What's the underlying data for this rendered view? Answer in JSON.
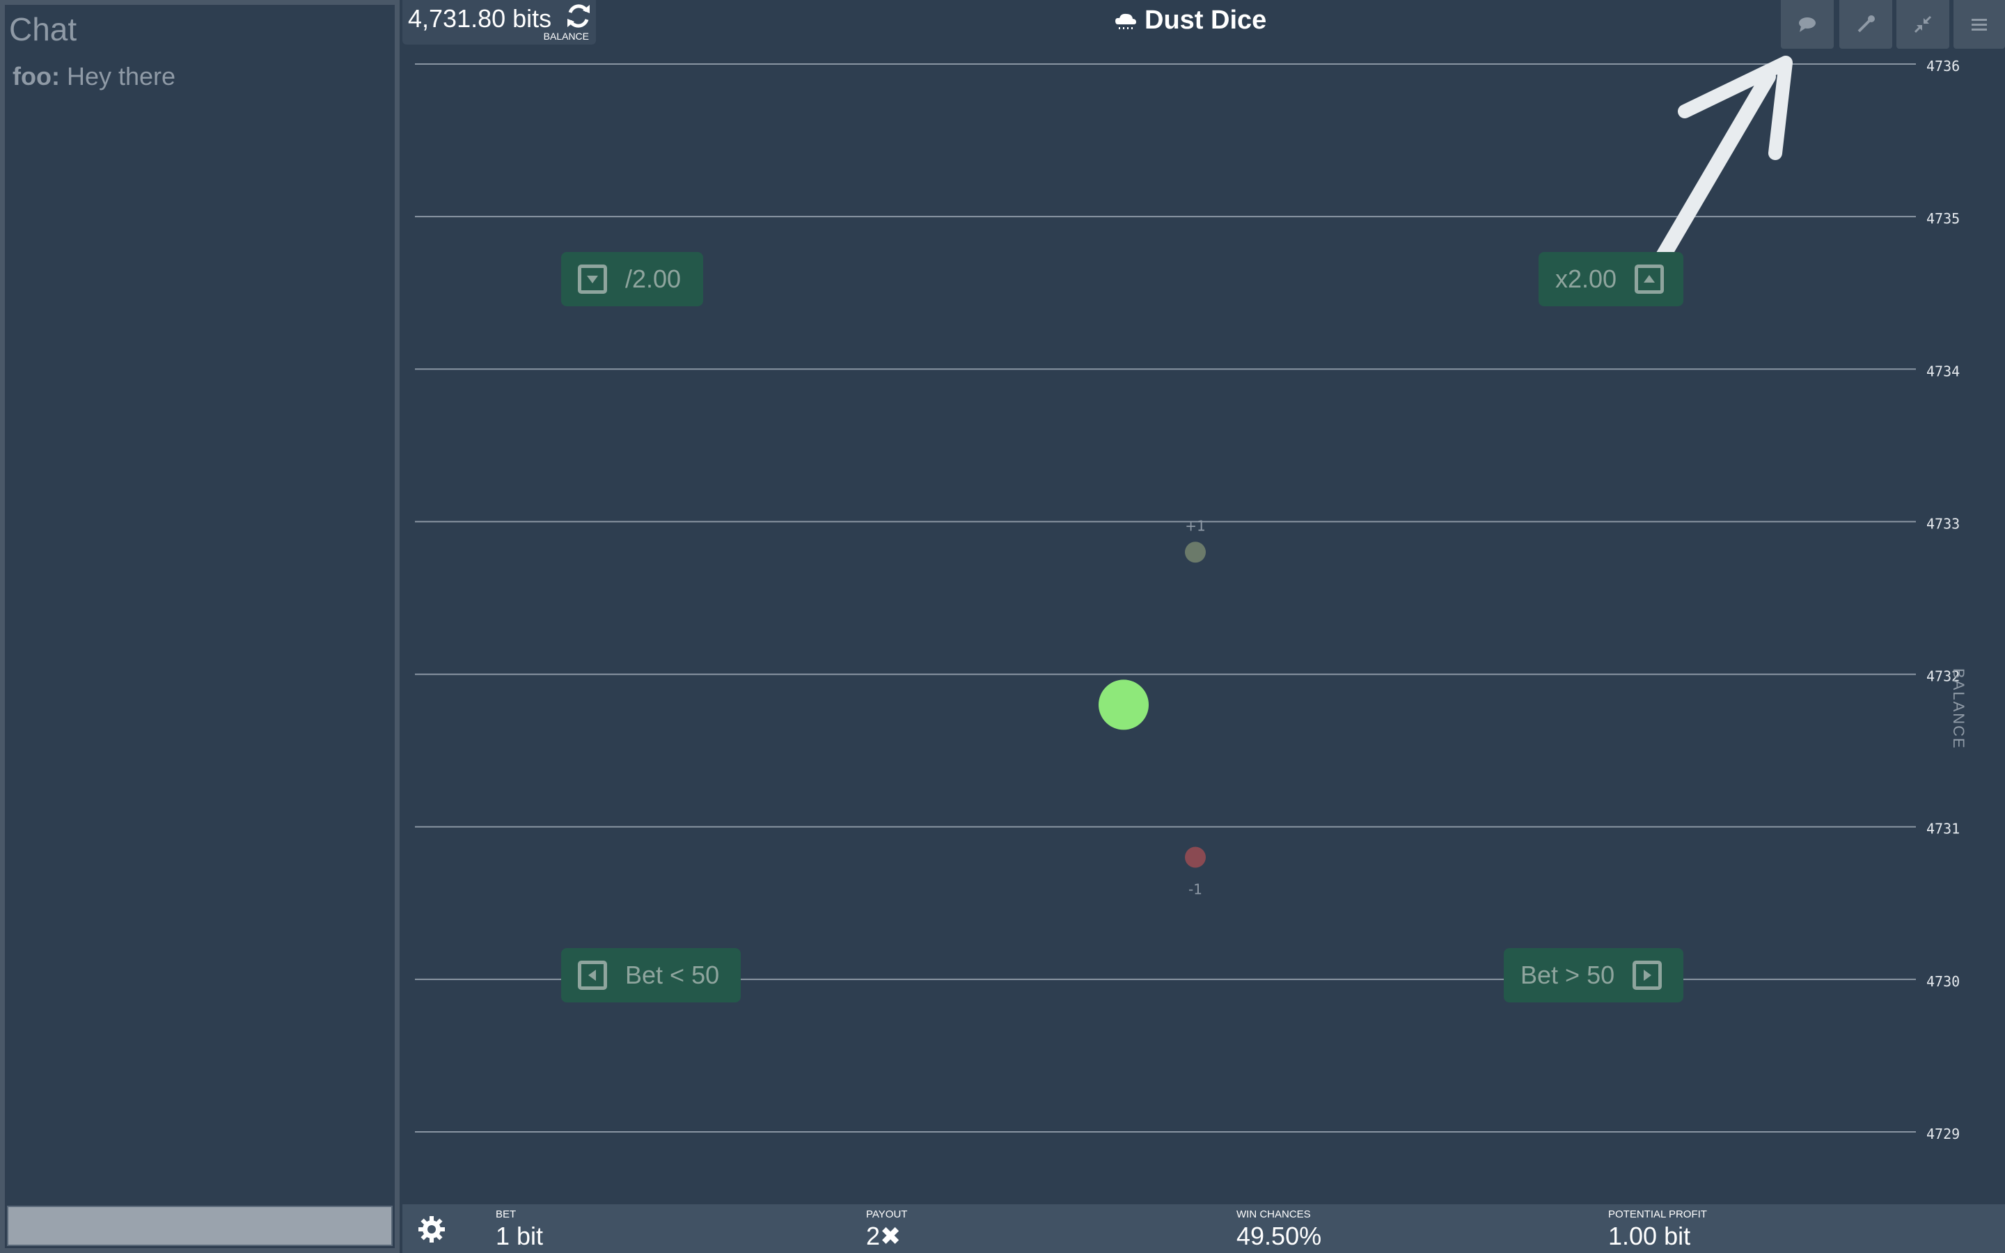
{
  "chat": {
    "title": "Chat",
    "messages": [
      {
        "user": "foo:",
        "text": "Hey there"
      }
    ],
    "input_value": ""
  },
  "balance": {
    "amount": "4,731.80 bits",
    "label": "BALANCE",
    "icon": "refresh-icon"
  },
  "app": {
    "title": "Dust Dice",
    "logo_icon": "cloud-icon"
  },
  "top_buttons": [
    {
      "name": "chat-toggle-button",
      "icon": "speech-bubble-icon"
    },
    {
      "name": "faucet-button",
      "icon": "pipette-icon"
    },
    {
      "name": "collapse-button",
      "icon": "compress-icon"
    },
    {
      "name": "menu-button",
      "icon": "hamburger-icon"
    }
  ],
  "actions": {
    "halve": "/2.00",
    "double": "x2.00",
    "bet_low": "Bet < 50",
    "bet_high": "Bet > 50"
  },
  "chart_data": {
    "type": "scatter",
    "y_label": "BALANCE",
    "ylim": [
      4729,
      4736
    ],
    "y_ticks": [
      4736,
      4735,
      4734,
      4733,
      4732,
      4731,
      4730,
      4729
    ],
    "points": [
      {
        "role": "current",
        "value": 4731.8,
        "color": "#8ee87a"
      },
      {
        "role": "win-preview",
        "value": 4732.8,
        "label": "+1",
        "color": "#6b7a6a"
      },
      {
        "role": "loss-preview",
        "value": 4730.8,
        "label": "-1",
        "color": "#8a4a52"
      }
    ]
  },
  "bottom": {
    "bet": {
      "label": "BET",
      "value": "1 bit"
    },
    "payout": {
      "label": "PAYOUT",
      "value": "2✖"
    },
    "win_chances": {
      "label": "WIN CHANCES",
      "value": "49.50%"
    },
    "profit": {
      "label": "POTENTIAL PROFIT",
      "value": "1.00 bit"
    }
  }
}
